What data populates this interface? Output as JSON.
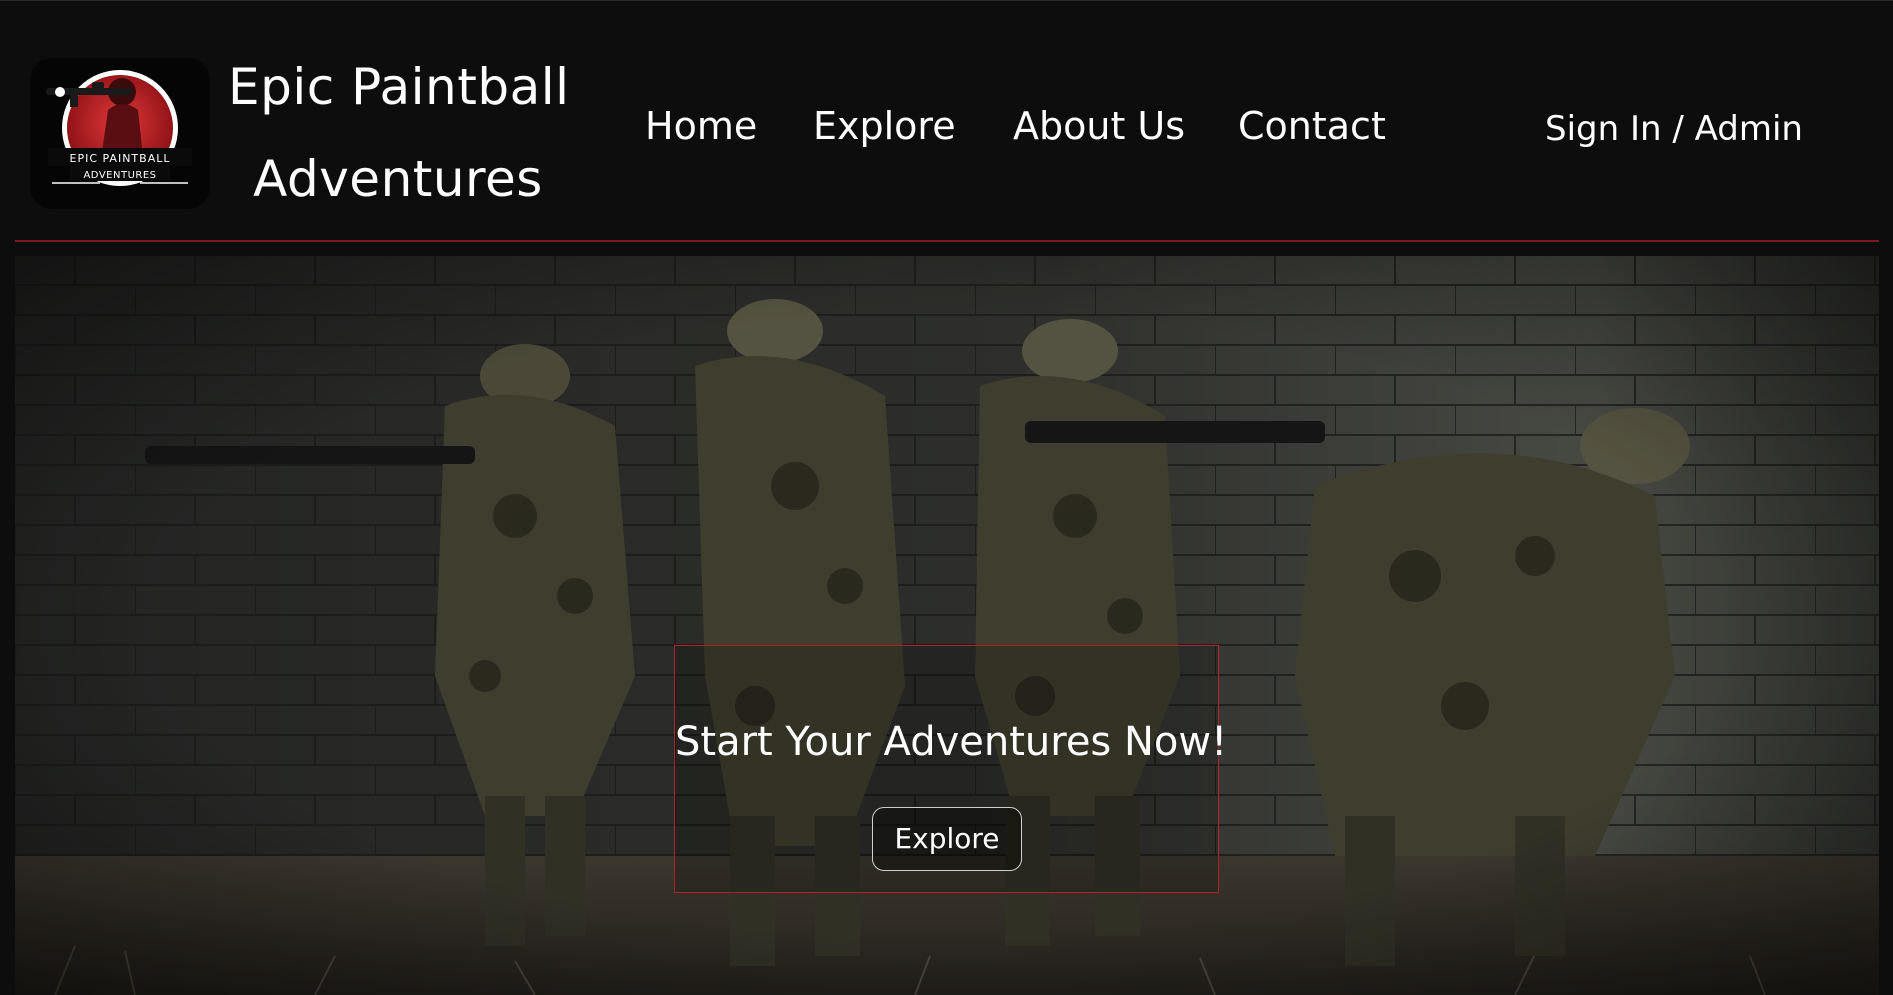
{
  "brand": {
    "logo_text_top": "EPIC PAINTBALL",
    "logo_text_bottom": "ADVENTURES",
    "title_line1": "Epic Paintball",
    "title_line2": "Adventures"
  },
  "nav": {
    "items": [
      {
        "label": "Home"
      },
      {
        "label": "Explore"
      },
      {
        "label": "About Us"
      },
      {
        "label": "Contact"
      }
    ],
    "signin_label": "Sign In / Admin"
  },
  "hero": {
    "cta_title": "Start Your Adventures Now!",
    "cta_button_label": "Explore"
  },
  "colors": {
    "background": "#0d0d0d",
    "accent_red": "#b3202a",
    "text": "#ffffff"
  }
}
